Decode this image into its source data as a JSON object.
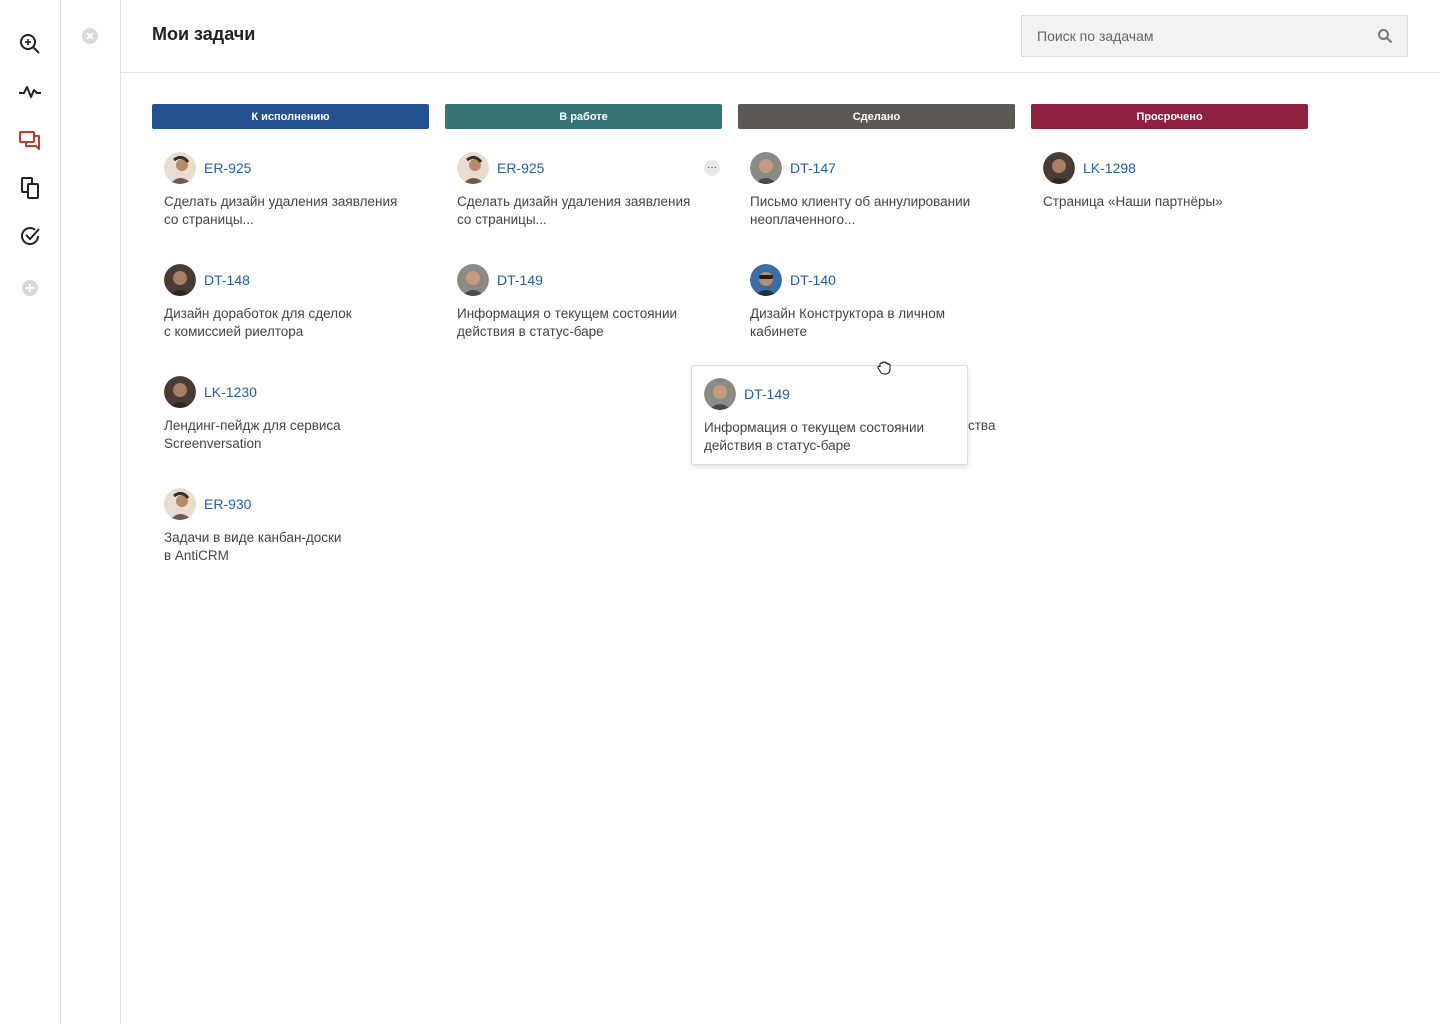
{
  "header": {
    "title": "Мои задачи",
    "search_placeholder": "Поиск по задачам"
  },
  "rail": {
    "icons": [
      "search-icon",
      "activity-icon",
      "chat-icon",
      "documents-icon",
      "tasks-icon",
      "add-icon"
    ],
    "active": "chat-icon",
    "active_color": "#c0392b"
  },
  "columns": [
    {
      "label": "К исполнению",
      "color": "#24508f",
      "cards": [
        {
          "id": "ER-925",
          "title_line1": "Сделать дизайн удаления заявления",
          "title_line2": "со страницы..."
        },
        {
          "id": "DT-148",
          "title_line1": "Дизайн доработок для сделок",
          "title_line2": "с комиссией риелтора"
        },
        {
          "id": "LK-1230",
          "title_line1": "Лендинг-пейдж для сервиса",
          "title_line2": "Screenversation"
        },
        {
          "id": "ER-930",
          "title_line1": "Задачи в виде канбан-доски",
          "title_line2": "в AntiCRM"
        }
      ]
    },
    {
      "label": "В работе",
      "color": "#357578",
      "cards": [
        {
          "id": "ER-925",
          "title_line1": "Сделать дизайн удаления заявления",
          "title_line2": "со страницы...",
          "has_menu": true
        },
        {
          "id": "DT-149",
          "title_line1": "Информация о текущем состоянии",
          "title_line2": "действия в статус-баре"
        }
      ]
    },
    {
      "label": "Сделано",
      "color": "#5b5752",
      "cards": [
        {
          "id": "DT-147",
          "title_line1": "Письмо клиенту об аннулировании",
          "title_line2": "неоплаченного..."
        },
        {
          "id": "DT-140",
          "title_line1": "Дизайн Конструктора в личном",
          "title_line2": "кабинете"
        }
      ]
    },
    {
      "label": "Просрочено",
      "color": "#8e2140",
      "cards": [
        {
          "id": "LK-1298",
          "title_line1": "Страница «Наши партнёры»",
          "title_line2": ""
        }
      ]
    }
  ],
  "dragging_card": {
    "id": "DT-149",
    "title_line1": "Информация о текущем состоянии",
    "title_line2": "действия в статус-баре"
  },
  "hidden_card_fragment": "ства",
  "more_glyph": "···"
}
